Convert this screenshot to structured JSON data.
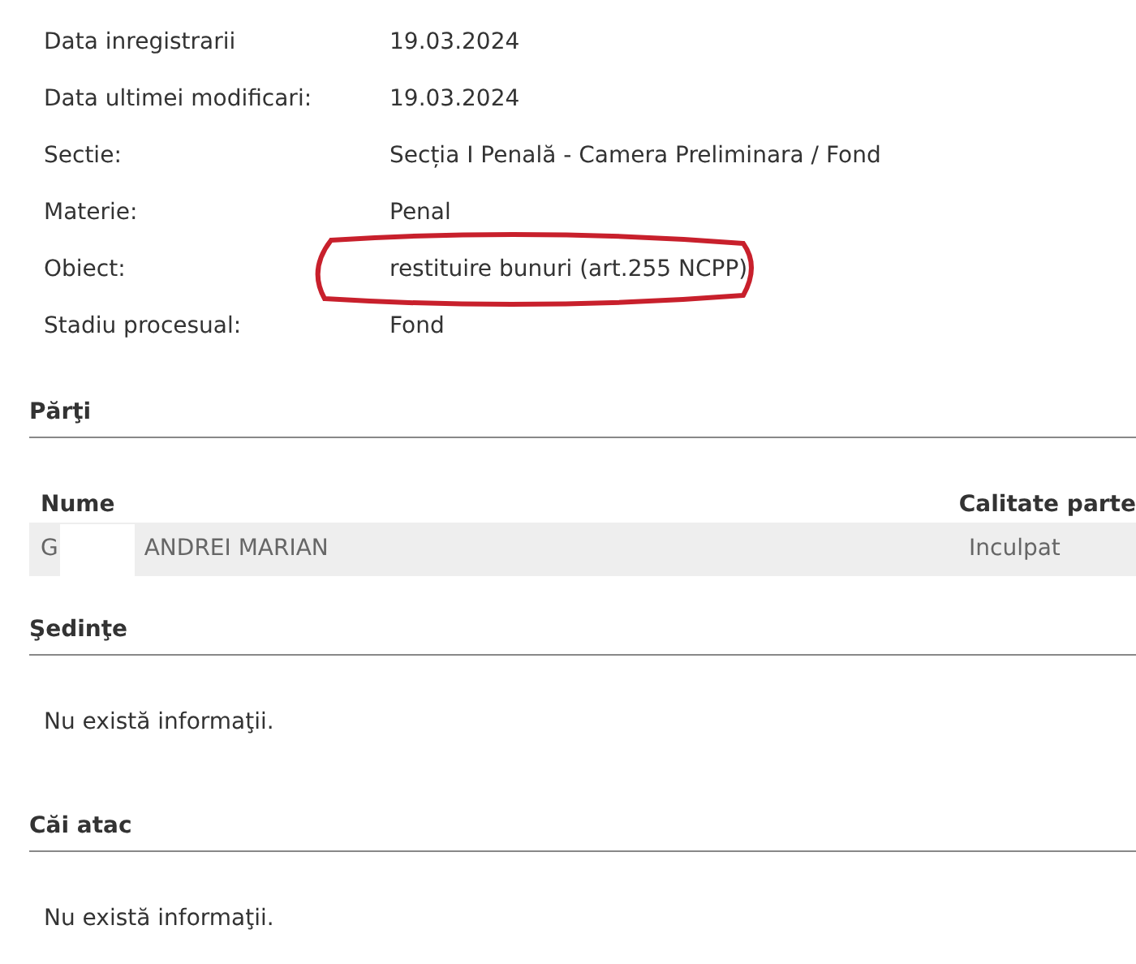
{
  "details": [
    {
      "label": "Data inregistrarii",
      "value": "19.03.2024",
      "highlighted": false
    },
    {
      "label": "Data ultimei modificari:",
      "value": "19.03.2024",
      "highlighted": false
    },
    {
      "label": "Sectie:",
      "value": "Secția I Penală - Camera Preliminara / Fond",
      "highlighted": false
    },
    {
      "label": "Materie:",
      "value": "Penal",
      "highlighted": false
    },
    {
      "label": "Obiect:",
      "value": "restituire bunuri (art.255 NCPP)",
      "highlighted": true
    },
    {
      "label": "Stadiu procesual:",
      "value": "Fond",
      "highlighted": false
    }
  ],
  "parti": {
    "title": "Părţi",
    "columns": [
      "Nume",
      "Calitate parte"
    ],
    "rows": [
      {
        "name_start": "G",
        "redacted": true,
        "name_end": "ANDREI MARIAN",
        "calitate": "Inculpat"
      }
    ]
  },
  "sedinte": {
    "title": "Şedinţe",
    "message": "Nu există informaţii."
  },
  "cai_atac": {
    "title": "Căi atac",
    "message": "Nu există informaţii."
  }
}
